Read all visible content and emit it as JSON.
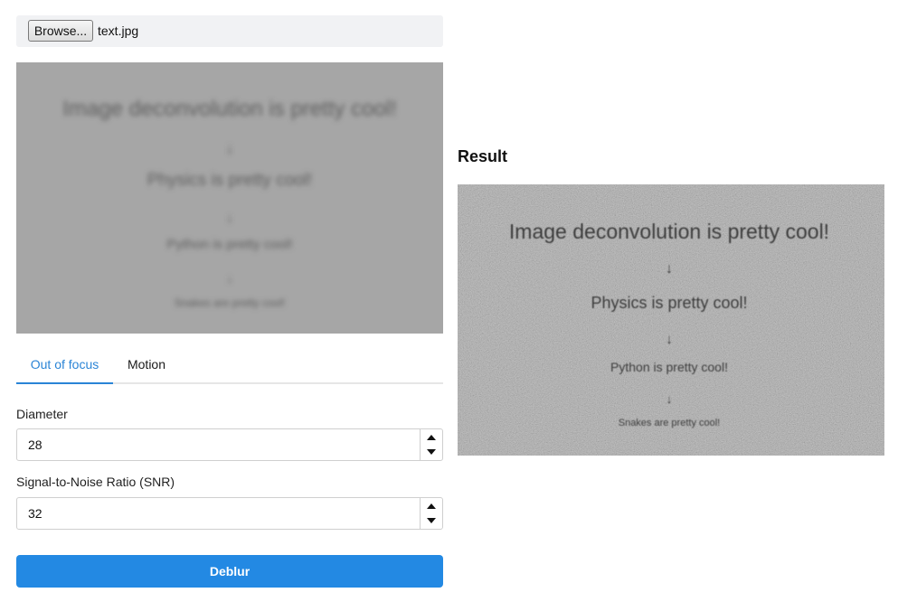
{
  "file_input": {
    "button_label": "Browse...",
    "file_name": "text.jpg"
  },
  "input_image": {
    "lines": [
      "Image deconvolution is pretty cool!",
      "↓",
      "Physics is pretty cool!",
      "↓",
      "Python is pretty cool!",
      "↓",
      "Snakes are pretty cool!"
    ]
  },
  "tabs": [
    {
      "label": "Out of focus",
      "active": true
    },
    {
      "label": "Motion",
      "active": false
    }
  ],
  "fields": {
    "diameter": {
      "label": "Diameter",
      "value": "28"
    },
    "snr": {
      "label": "Signal-to-Noise Ratio (SNR)",
      "value": "32"
    }
  },
  "deblur_button": {
    "label": "Deblur"
  },
  "result": {
    "heading": "Result",
    "lines": [
      "Image deconvolution is pretty cool!",
      "↓",
      "Physics is pretty cool!",
      "↓",
      "Python is pretty cool!",
      "↓",
      "Snakes are pretty cool!"
    ]
  },
  "colors": {
    "accent": "#2389e3",
    "active_tab": "#2a84d6"
  },
  "icons": [
    "spin-up-icon",
    "spin-down-icon"
  ]
}
